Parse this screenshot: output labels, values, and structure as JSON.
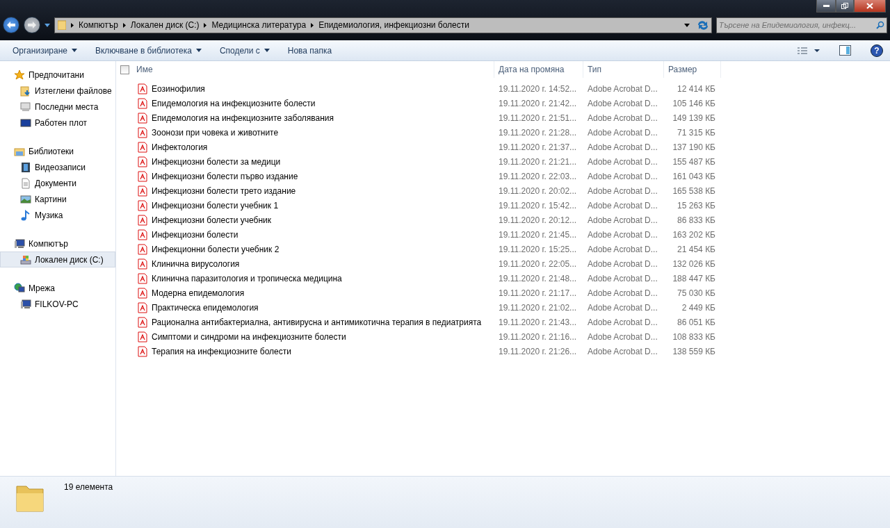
{
  "breadcrumb": [
    "Компютър",
    "Локален диск (C:)",
    "Медицинска литература",
    "Епидемиология, инфекциозни болести"
  ],
  "search": {
    "placeholder": "Търсене на Епидемиология, инфекц..."
  },
  "toolbar": [
    {
      "label": "Организиране",
      "kind": "dropdown"
    },
    {
      "label": "Включване в библиотека",
      "kind": "dropdown"
    },
    {
      "label": "Сподели с",
      "kind": "dropdown"
    },
    {
      "label": "Нова папка",
      "kind": "button"
    }
  ],
  "help_button": "?",
  "select_all": {
    "checked": false
  },
  "sidebar": [
    {
      "label": "Предпочитани",
      "children": [
        {
          "label": "Изтеглени файлове",
          "selected": false
        },
        {
          "label": "Последни места",
          "selected": false
        },
        {
          "label": "Работен плот",
          "selected": false
        }
      ]
    },
    {
      "label": "Библиотеки",
      "children": [
        {
          "label": "Видеозаписи",
          "selected": false
        },
        {
          "label": "Документи",
          "selected": false
        },
        {
          "label": "Картини",
          "selected": false
        },
        {
          "label": "Музика",
          "selected": false
        }
      ]
    },
    {
      "label": "Компютър",
      "children": [
        {
          "label": "Локален диск (C:)",
          "selected": true
        }
      ]
    },
    {
      "label": "Мрежа",
      "children": [
        {
          "label": "FILKOV-PC",
          "selected": false
        }
      ]
    }
  ],
  "table": {
    "columns": [
      "Име",
      "Дата на промяна",
      "Тип",
      "Размер"
    ],
    "rows": [
      [
        "Еозинофилия",
        "19.11.2020 г. 14:52...",
        "Adobe Acrobat D...",
        "12 414 КБ"
      ],
      [
        "Епидемология на инфекциозните болести",
        "19.11.2020 г. 21:42...",
        "Adobe Acrobat D...",
        "105 146 КБ"
      ],
      [
        "Епидемология на инфекциозните заболявания",
        "19.11.2020 г. 21:51...",
        "Adobe Acrobat D...",
        "149 139 КБ"
      ],
      [
        "Зоонози при човека и животните",
        "19.11.2020 г. 21:28...",
        "Adobe Acrobat D...",
        "71 315 КБ"
      ],
      [
        "Инфектология",
        "19.11.2020 г. 21:37...",
        "Adobe Acrobat D...",
        "137 190 КБ"
      ],
      [
        "Инфекциозни болести за медици",
        "19.11.2020 г. 21:21...",
        "Adobe Acrobat D...",
        "155 487 КБ"
      ],
      [
        "Инфекциозни болести първо издание",
        "19.11.2020 г. 22:03...",
        "Adobe Acrobat D...",
        "161 043 КБ"
      ],
      [
        "Инфекциозни болести трето издание",
        "19.11.2020 г. 20:02...",
        "Adobe Acrobat D...",
        "165 538 КБ"
      ],
      [
        "Инфекциозни болести учебник 1",
        "19.11.2020 г. 15:42...",
        "Adobe Acrobat D...",
        "15 263 КБ"
      ],
      [
        "Инфекциозни болести учебник",
        "19.11.2020 г. 20:12...",
        "Adobe Acrobat D...",
        "86 833 КБ"
      ],
      [
        "Инфекциозни болести",
        "19.11.2020 г. 21:45...",
        "Adobe Acrobat D...",
        "163 202 КБ"
      ],
      [
        "Инфекционни болести учебник 2",
        "19.11.2020 г. 15:25...",
        "Adobe Acrobat D...",
        "21 454 КБ"
      ],
      [
        "Клинична вирусология",
        "19.11.2020 г. 22:05...",
        "Adobe Acrobat D...",
        "132 026 КБ"
      ],
      [
        "Клинична паразитология и тропическа медицина",
        "19.11.2020 г. 21:48...",
        "Adobe Acrobat D...",
        "188 447 КБ"
      ],
      [
        "Модерна епидемология",
        "19.11.2020 г. 21:17...",
        "Adobe Acrobat D...",
        "75 030 КБ"
      ],
      [
        "Практическа епидемология",
        "19.11.2020 г. 21:02...",
        "Adobe Acrobat D...",
        "2 449 КБ"
      ],
      [
        "Рационална антибактериална, антивирусна и антимикотична терапия в педиатрията",
        "19.11.2020 г. 21:43...",
        "Adobe Acrobat D...",
        "86 051 КБ"
      ],
      [
        "Симптоми и синдроми на инфекциозните болести",
        "19.11.2020 г. 21:16...",
        "Adobe Acrobat D...",
        "108 833 КБ"
      ],
      [
        "Терапия на инфекциозните болести",
        "19.11.2020 г. 21:26...",
        "Adobe Acrobat D...",
        "138 559 КБ"
      ]
    ]
  },
  "status_bar": {
    "count": "19 елемента"
  }
}
